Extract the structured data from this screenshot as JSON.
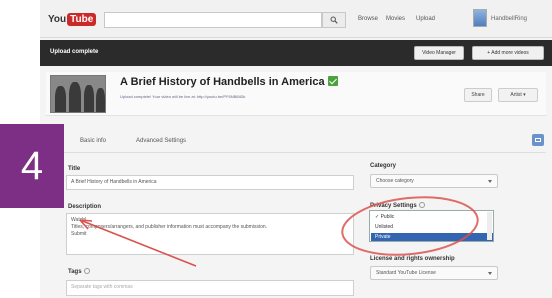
{
  "colors": {
    "step_block": "#7d2f86",
    "annotation": "#d9534f",
    "upload_bar": "#2b2b2b",
    "selected_option": "#3465b0",
    "verified_check": "#4aa33c"
  },
  "step": {
    "number": "4"
  },
  "header": {
    "logo": {
      "you": "You",
      "tube": "Tube"
    },
    "search_placeholder": "",
    "search_icon": "search-icon",
    "nav": [
      "Browse",
      "Movies",
      "Upload"
    ],
    "user": "HandbellRing"
  },
  "upload_bar": {
    "status": "Upload complete",
    "buttons": [
      "Video Manager",
      "+ Add more videos"
    ]
  },
  "video": {
    "title": "A Brief History of Handbells in America",
    "meta_line1": "Upload complete! Your video will be live at: http://youtu.be/PF6NB8IiDk",
    "meta_line2": "",
    "buttons": [
      "Share",
      "Artist ▾"
    ]
  },
  "tabs": [
    "Basic info",
    "Advanced Settings"
  ],
  "form": {
    "title_label": "Title",
    "title_value": "A Brief History of Handbells in America",
    "description_label": "Description",
    "description_lines": [
      "Watch!",
      "Titles, composers/arrangers, and publisher information must accompany the submission.",
      "Submit"
    ],
    "tags_label": "Tags",
    "tags_placeholder": "Separate tags with commas",
    "category_label": "Category",
    "category_value": "Choose category",
    "privacy_label": "Privacy Settings",
    "privacy_options": [
      "✓ Public",
      "Unlisted",
      "Private"
    ],
    "privacy_selected_index": 2,
    "license_label": "License and rights ownership",
    "license_value": "Standard YouTube License"
  }
}
